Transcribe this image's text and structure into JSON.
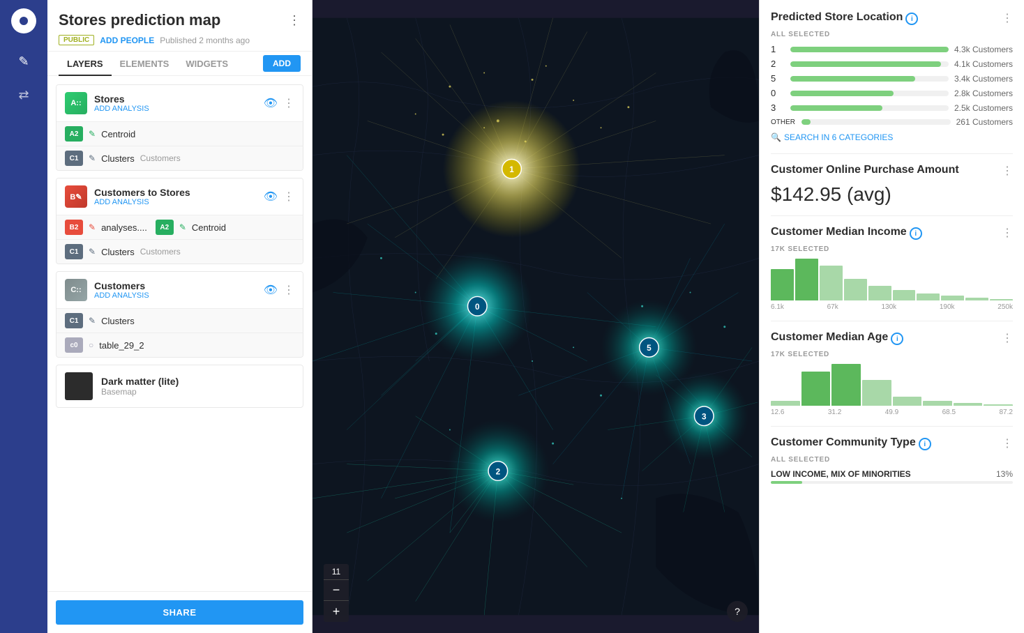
{
  "toolbar": {
    "logo_alt": "CARTO logo"
  },
  "sidebar": {
    "title": "Stores prediction map",
    "more_label": "⋮",
    "badge_public": "PUBLIC",
    "add_people_label": "ADD PEOPLE",
    "published_text": "Published 2 months ago",
    "tabs": [
      {
        "label": "LAYERS",
        "active": true
      },
      {
        "label": "ELEMENTS",
        "active": false
      },
      {
        "label": "WIDGETS",
        "active": false
      }
    ],
    "add_btn": "ADD",
    "layers": [
      {
        "id": "stores",
        "icon_label": "A::",
        "icon_class": "icon-stores",
        "name": "Stores",
        "add_analysis": "ADD ANALYSIS",
        "eye": true,
        "sub_layers": [
          {
            "badge": "A2",
            "badge_class": "sub-green",
            "icon": "✎",
            "label": "Centroid"
          },
          {
            "badge": "C1",
            "badge_class": "sub-dark",
            "icon": "✎",
            "label": "Clusters",
            "secondary": "Customers"
          }
        ]
      },
      {
        "id": "customers-to-stores",
        "icon_label": "B✎",
        "icon_class": "icon-customers-stores",
        "name": "Customers to Stores",
        "add_analysis": "ADD ANALYSIS",
        "eye": true,
        "sub_layers": [
          {
            "badge": "B2",
            "badge_class": "sub-red",
            "icon": "✎",
            "label": "analyses....",
            "extra_badge": "A2",
            "extra_class": "sub-green",
            "extra_label": "Centroid"
          },
          {
            "badge": "C1",
            "badge_class": "sub-dark",
            "icon": "✎",
            "label": "Clusters",
            "secondary": "Customers"
          }
        ]
      },
      {
        "id": "customers",
        "icon_label": "C::",
        "icon_class": "icon-customers",
        "name": "Customers",
        "add_analysis": "ADD ANALYSIS",
        "eye": true,
        "sub_layers": [
          {
            "badge": "C1",
            "badge_class": "sub-dark",
            "icon": "✎",
            "label": "Clusters"
          },
          {
            "badge": "c0",
            "badge_class": "sub-light",
            "icon": "○",
            "label": "table_29_2"
          }
        ]
      }
    ],
    "basemap": {
      "name": "Dark matter (lite)",
      "type": "Basemap"
    },
    "share_btn": "SHARE"
  },
  "map": {
    "zoom_level": "11",
    "zoom_in": "+",
    "zoom_out": "−",
    "help": "?"
  },
  "right_panel": {
    "predicted_store": {
      "title": "Predicted Store Location",
      "section_label": "ALL SELECTED",
      "stores": [
        {
          "num": "1",
          "pct": 100,
          "val": "4.3k Customers"
        },
        {
          "num": "2",
          "pct": 95,
          "val": "4.1k Customers"
        },
        {
          "num": "5",
          "pct": 79,
          "val": "3.4k Customers"
        },
        {
          "num": "0",
          "pct": 65,
          "val": "2.8k Customers"
        },
        {
          "num": "3",
          "pct": 58,
          "val": "2.5k Customers"
        },
        {
          "num": "OTHER",
          "pct": 6,
          "val": "261 Customers"
        }
      ],
      "search_link": "SEARCH IN 6 CATEGORIES"
    },
    "purchase": {
      "title": "Customer Online Purchase Amount",
      "value": "$142.95 (avg)"
    },
    "median_income": {
      "title": "Customer Median Income",
      "section_label": "17K SELECTED",
      "hist_bars": [
        45,
        72,
        60,
        38,
        25,
        18,
        12,
        8,
        5,
        3
      ],
      "labels": [
        "6.1k",
        "67k",
        "130k",
        "190k",
        "250k"
      ]
    },
    "median_age": {
      "title": "Customer Median Age",
      "section_label": "17K SELECTED",
      "hist_bars": [
        8,
        55,
        68,
        42,
        15,
        8,
        4,
        2
      ],
      "labels": [
        "12.6",
        "31.2",
        "49.9",
        "68.5",
        "87.2"
      ]
    },
    "community": {
      "title": "Customer Community Type",
      "section_label": "ALL SELECTED",
      "row_text": "LOW INCOME, MIX OF MINORITIES",
      "row_val": "13%",
      "row_pct": 13
    }
  }
}
